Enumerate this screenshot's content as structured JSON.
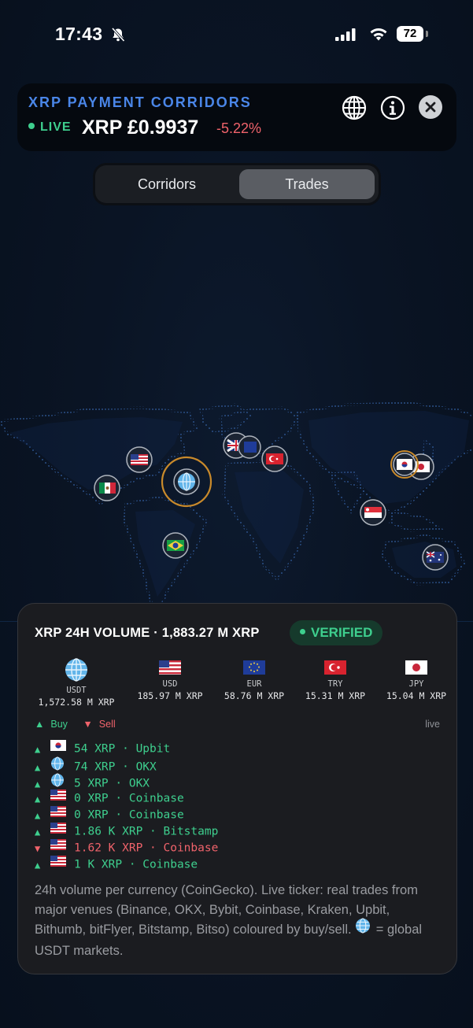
{
  "status_bar": {
    "time": "17:43",
    "battery": "72"
  },
  "header": {
    "title": "XRP PAYMENT CORRIDORS",
    "live_label": "LIVE",
    "price": "XRP £0.9937",
    "change": "-5.22%"
  },
  "segments": {
    "corridors": "Corridors",
    "trades": "Trades",
    "active": "Trades"
  },
  "map_markers": [
    "mexico-flag",
    "usa-flag",
    "globe-usdt",
    "uk-flag",
    "eu-flag",
    "turkey-flag",
    "korea-flag",
    "japan-flag",
    "singapore-flag",
    "brazil-flag",
    "australia-flag"
  ],
  "volume": {
    "title": "XRP 24H VOLUME · 1,883.27 M XRP",
    "verified": "VERIFIED",
    "currencies": [
      {
        "code": "USDT",
        "amount": "1,572.58 M XRP",
        "icon": "globe"
      },
      {
        "code": "USD",
        "amount": "185.97 M XRP",
        "icon": "usa-flag"
      },
      {
        "code": "EUR",
        "amount": "58.76 M XRP",
        "icon": "eu-flag"
      },
      {
        "code": "TRY",
        "amount": "15.31 M XRP",
        "icon": "turkey-flag"
      },
      {
        "code": "JPY",
        "amount": "15.04 M XRP",
        "icon": "japan-flag"
      }
    ],
    "legend": {
      "buy": "Buy",
      "sell": "Sell",
      "live": "live"
    },
    "trades": [
      {
        "side": "buy",
        "icon": "korea-flag",
        "text": "54 XRP · Upbit"
      },
      {
        "side": "buy",
        "icon": "globe",
        "text": "74 XRP · OKX"
      },
      {
        "side": "buy",
        "icon": "globe",
        "text": "5 XRP · OKX"
      },
      {
        "side": "buy",
        "icon": "usa-flag",
        "text": "0 XRP · Coinbase"
      },
      {
        "side": "buy",
        "icon": "usa-flag",
        "text": "0 XRP · Coinbase"
      },
      {
        "side": "buy",
        "icon": "usa-flag",
        "text": "1.86 K XRP · Bitstamp"
      },
      {
        "side": "sell",
        "icon": "usa-flag",
        "text": "1.62 K XRP · Coinbase"
      },
      {
        "side": "buy",
        "icon": "usa-flag",
        "text": "1 K XRP · Coinbase"
      }
    ],
    "note": "24h volume per currency (CoinGecko). Live ticker: real trades from major venues (Binance, OKX, Bybit, Coinbase, Kraken, Upbit, Bithumb, bitFlyer, Bitstamp, Bitso) coloured by buy/sell.",
    "note_legend": "= global USDT markets."
  },
  "colors": {
    "buy": "#3ecf8e",
    "sell": "#f0636b",
    "accent": "#4a86e8",
    "highlight_ring": "#c98a2b"
  }
}
